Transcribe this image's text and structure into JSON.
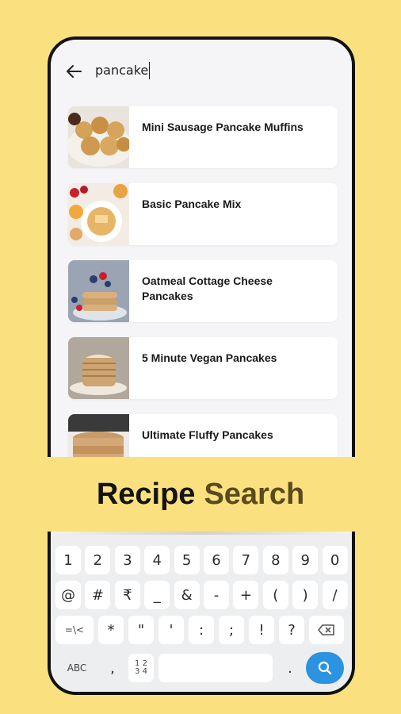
{
  "search": {
    "query": "pancake"
  },
  "recipes": [
    {
      "title": "Mini Sausage Pancake Muffins"
    },
    {
      "title": "Basic Pancake Mix"
    },
    {
      "title": "Oatmeal Cottage Cheese Pancakes"
    },
    {
      "title": "5 Minute Vegan Pancakes"
    },
    {
      "title": "Ultimate Fluffy Pancakes"
    }
  ],
  "banner": {
    "word1": "Recipe",
    "word2": "Search"
  },
  "keyboard": {
    "row1": [
      "1",
      "2",
      "3",
      "4",
      "5",
      "6",
      "7",
      "8",
      "9",
      "0"
    ],
    "row2": [
      "@",
      "#",
      "₹",
      "_",
      "&",
      "-",
      "+",
      "(",
      ")",
      "/"
    ],
    "row3": [
      "=\\<",
      "*",
      "\"",
      "'",
      ":",
      ";",
      "!",
      "?"
    ],
    "row4": {
      "abc": "ABC",
      "comma": ",",
      "num_top": "1 2",
      "num_bottom": "3 4",
      "period": "."
    }
  },
  "colors": {
    "background": "#fbe07f",
    "banner_word2": "#5b4a1c",
    "search_key": "#2b93e0"
  }
}
